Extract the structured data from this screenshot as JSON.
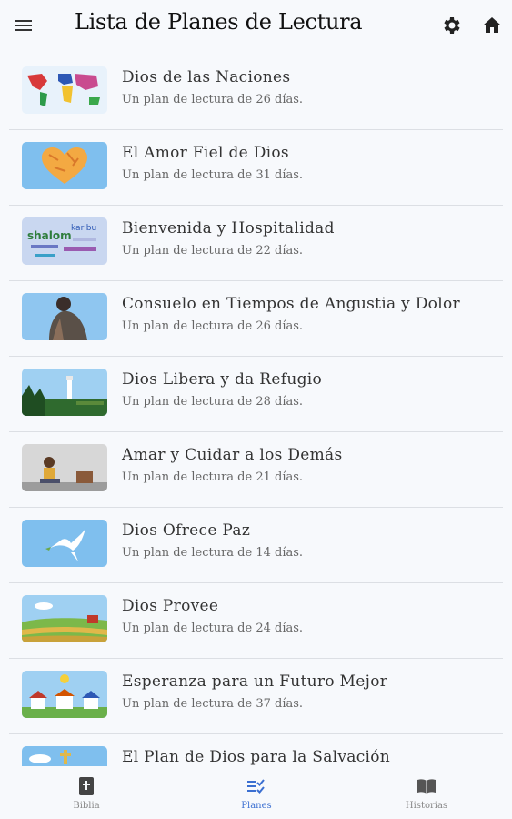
{
  "header": {
    "title": "Lista de Planes de Lectura",
    "menu_icon": "menu-icon",
    "settings_icon": "gear-icon",
    "home_icon": "home-icon"
  },
  "plans": [
    {
      "title": "Dios de las Naciones",
      "subtitle": "Un plan de lectura de 26 días."
    },
    {
      "title": "El Amor Fiel de Dios",
      "subtitle": "Un plan de lectura de 31 días."
    },
    {
      "title": "Bienvenida y Hospitalidad",
      "subtitle": "Un plan de lectura de 22 días."
    },
    {
      "title": "Consuelo en Tiempos de Angustia y Dolor",
      "subtitle": "Un plan de lectura de 26 días."
    },
    {
      "title": "Dios Libera y da Refugio",
      "subtitle": "Un plan de lectura de 28 días."
    },
    {
      "title": "Amar y Cuidar a los Demás",
      "subtitle": "Un plan de lectura de 21 días."
    },
    {
      "title": "Dios Ofrece Paz",
      "subtitle": "Un plan de lectura de 14 días."
    },
    {
      "title": "Dios Provee",
      "subtitle": "Un plan de lectura de 24 días."
    },
    {
      "title": "Esperanza para un Futuro Mejor",
      "subtitle": "Un plan de lectura de 37 días."
    },
    {
      "title": "El Plan de Dios para la Salvación",
      "subtitle": ""
    }
  ],
  "thumb_words": {
    "shalom": "shalom",
    "karibu": "karibu"
  },
  "bottom_nav": [
    {
      "label": "Biblia",
      "icon": "bible-icon",
      "active": false
    },
    {
      "label": "Planes",
      "icon": "checklist-icon",
      "active": true
    },
    {
      "label": "Historias",
      "icon": "book-icon",
      "active": false
    }
  ],
  "colors": {
    "accent": "#3b6fd1",
    "background": "#f7f9fc",
    "divider": "#dcdfe4",
    "thumb_sky": "#7fbfee"
  }
}
